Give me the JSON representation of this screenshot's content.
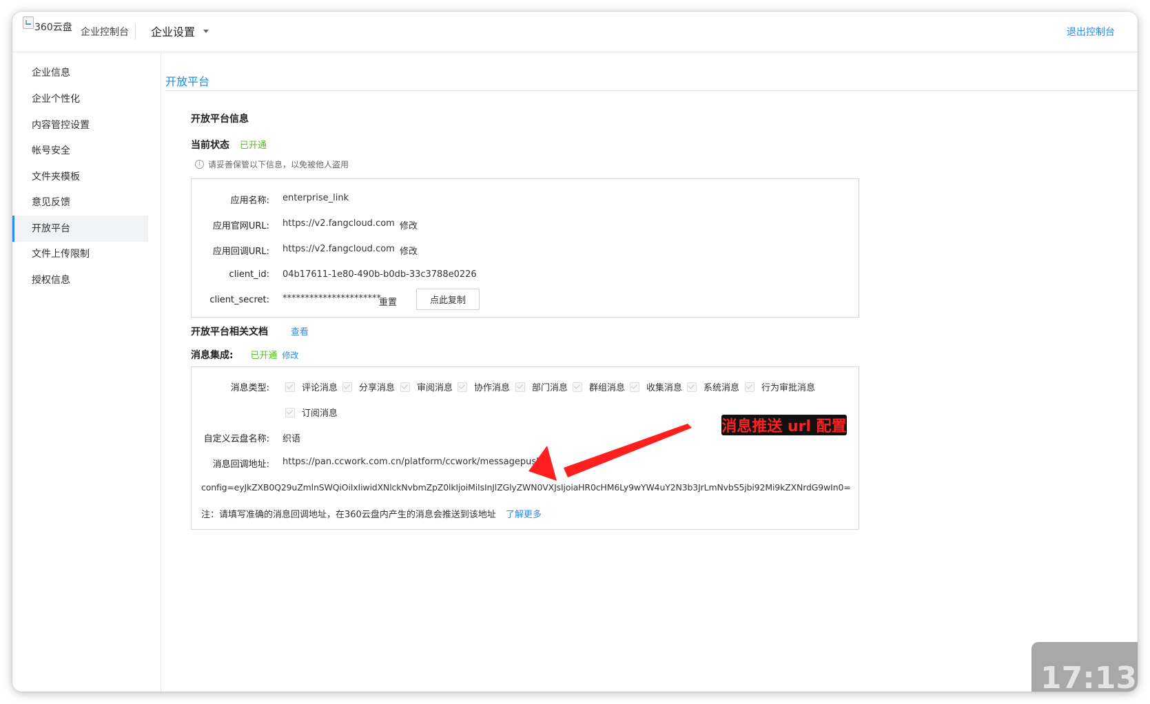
{
  "header": {
    "logo_alt": "360云盘",
    "console_label": "企业控制台",
    "settings_menu": "企业设置",
    "exit_link": "退出控制台"
  },
  "sidebar": {
    "items": [
      {
        "label": "企业信息"
      },
      {
        "label": "企业个性化"
      },
      {
        "label": "内容管控设置"
      },
      {
        "label": "帐号安全"
      },
      {
        "label": "文件夹模板"
      },
      {
        "label": "意见反馈"
      },
      {
        "label": "开放平台",
        "active": true
      },
      {
        "label": "文件上传限制"
      },
      {
        "label": "授权信息"
      }
    ]
  },
  "main": {
    "title": "开放平台",
    "info_title": "开放平台信息",
    "status_label": "当前状态",
    "status_value": "已开通",
    "notice": "请妥善保管以下信息，以免被他人盗用",
    "app": {
      "name_label": "应用名称:",
      "name_value": "enterprise_link",
      "site_url_label": "应用官网URL:",
      "site_url_value": "https://v2.fangcloud.com",
      "callback_url_label": "应用回调URL:",
      "callback_url_value": "https://v2.fangcloud.com",
      "edit_link": "修改",
      "client_id_label": "client_id:",
      "client_id_value": "04b17611-1e80-490b-b0db-33c3788e0226",
      "client_secret_label": "client_secret:",
      "client_secret_value": "**********************",
      "reset_link": "重置",
      "copy_button": "点此复制"
    },
    "docs_label": "开放平台相关文档",
    "docs_link": "查看",
    "msg_label": "消息集成:",
    "msg_status": "已开通",
    "msg_edit": "修改",
    "messages": {
      "type_label": "消息类型:",
      "types": [
        "评论消息",
        "分享消息",
        "审阅消息",
        "协作消息",
        "部门消息",
        "群组消息",
        "收集消息",
        "系统消息",
        "行为审批消息",
        "订阅消息"
      ],
      "custom_name_label": "自定义云盘名称:",
      "custom_name_value": "织语",
      "callback_label": "消息回调地址:",
      "callback_value": "https://pan.ccwork.com.cn/platform/ccwork/messagepush?",
      "config_value": "config=eyJkZXB0Q29uZmlnSWQiOiIxIiwidXNlckNvbmZpZ0lkIjoiMiIsInJlZGlyZWN0VXJsIjoiaHR0cHM6Ly9wYW4uY2N3b3JrLmNvbS5jbi92Mi9kZXNrdG9wIn0=",
      "note": "注：请填写准确的消息回调地址，在360云盘内产生的消息会推送到该地址",
      "learn_more": "了解更多"
    },
    "annotation": "消息推送 url 配置"
  },
  "overlay": {
    "timer": "17:13"
  },
  "colors": {
    "accent": "#2d8cf0",
    "title_blue": "#1d8ce0",
    "status_green": "#52c41a",
    "annotation_red": "#ff1f1f"
  }
}
